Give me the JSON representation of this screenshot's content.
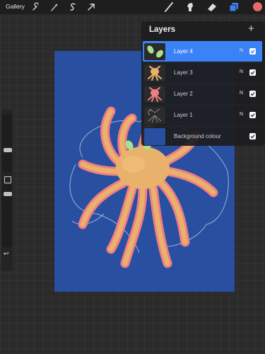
{
  "topbar": {
    "gallery_label": "Gallery",
    "tools_left": [
      "wrench-icon",
      "magic-wand-icon",
      "selection-s-icon",
      "transform-arrow-icon"
    ],
    "tools_right": [
      "brush-icon",
      "smudge-icon",
      "eraser-icon",
      "layers-icon"
    ],
    "active_color": "#e56a6a"
  },
  "layers_panel": {
    "title": "Layers",
    "add_label": "+",
    "layers": [
      {
        "name": "Layer 4",
        "blend": "N",
        "visible": true,
        "selected": true
      },
      {
        "name": "Layer 3",
        "blend": "N",
        "visible": true,
        "selected": false
      },
      {
        "name": "Layer 2",
        "blend": "N",
        "visible": true,
        "selected": false
      },
      {
        "name": "Layer 1",
        "blend": "N",
        "visible": true,
        "selected": false
      },
      {
        "name": "Background colour",
        "blend": "",
        "visible": true,
        "selected": false
      }
    ]
  },
  "sidebar": {
    "brush_size": 0.25,
    "opacity": 0.5,
    "undo_label": "↩"
  },
  "colors": {
    "canvas_background": "#284fa0",
    "octopus_body": "#e9b26c",
    "octopus_outline": "#f07d84",
    "leaf_green": "#a8e08f",
    "selection_blue": "#3b82f6"
  }
}
